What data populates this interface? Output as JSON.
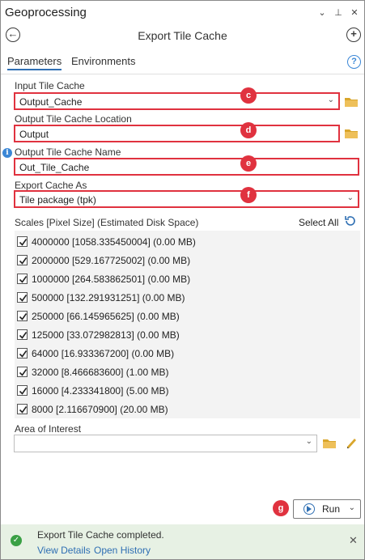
{
  "window": {
    "title": "Geoprocessing",
    "chevron_glyph": "⌄",
    "pin_glyph": "⊥",
    "close_glyph": "✕"
  },
  "header": {
    "back_glyph": "←",
    "tool_title": "Export Tile Cache",
    "add_glyph": "+"
  },
  "tabs": [
    {
      "label": "Parameters",
      "active": true
    },
    {
      "label": "Environments",
      "active": false
    }
  ],
  "help_glyph": "?",
  "params": {
    "input_tile_cache": {
      "label": "Input Tile Cache",
      "value": "Output_Cache",
      "badge": "c"
    },
    "output_location": {
      "label": "Output Tile Cache Location",
      "value": "Output",
      "badge": "d"
    },
    "output_name": {
      "label": "Output Tile Cache Name",
      "value": "Out_Tile_Cache",
      "badge": "e"
    },
    "export_as": {
      "label": "Export Cache As",
      "value": "Tile package (tpk)",
      "badge": "f"
    },
    "area_of_interest": {
      "label": "Area of Interest",
      "value": ""
    }
  },
  "info_glyph": "i",
  "dropdown_glyph": "⌄",
  "scales": {
    "header": "Scales [Pixel Size] (Estimated Disk Space)",
    "select_all": "Select All",
    "items": [
      {
        "text": "4000000 [1058.335450004] (0.00 MB)",
        "checked": true
      },
      {
        "text": "2000000 [529.167725002] (0.00 MB)",
        "checked": true
      },
      {
        "text": "1000000 [264.583862501] (0.00 MB)",
        "checked": true
      },
      {
        "text": "500000 [132.291931251] (0.00 MB)",
        "checked": true
      },
      {
        "text": "250000 [66.145965625] (0.00 MB)",
        "checked": true
      },
      {
        "text": "125000 [33.072982813] (0.00 MB)",
        "checked": true
      },
      {
        "text": "64000 [16.933367200] (0.00 MB)",
        "checked": true
      },
      {
        "text": "32000 [8.466683600] (1.00 MB)",
        "checked": true
      },
      {
        "text": "16000 [4.233341800] (5.00 MB)",
        "checked": true
      },
      {
        "text": "8000 [2.116670900] (20.00 MB)",
        "checked": true
      }
    ]
  },
  "run": {
    "label": "Run",
    "badge": "g"
  },
  "status": {
    "ok_glyph": "✓",
    "message": "Export Tile Cache completed.",
    "view_details": "View Details",
    "open_history": "Open History",
    "close_glyph": "✕"
  },
  "colors": {
    "highlight": "#e0323f",
    "accent": "#2f6fb3",
    "folder": "#d9a62c",
    "success_bg": "#e7f1e4",
    "success": "#3aa045"
  }
}
